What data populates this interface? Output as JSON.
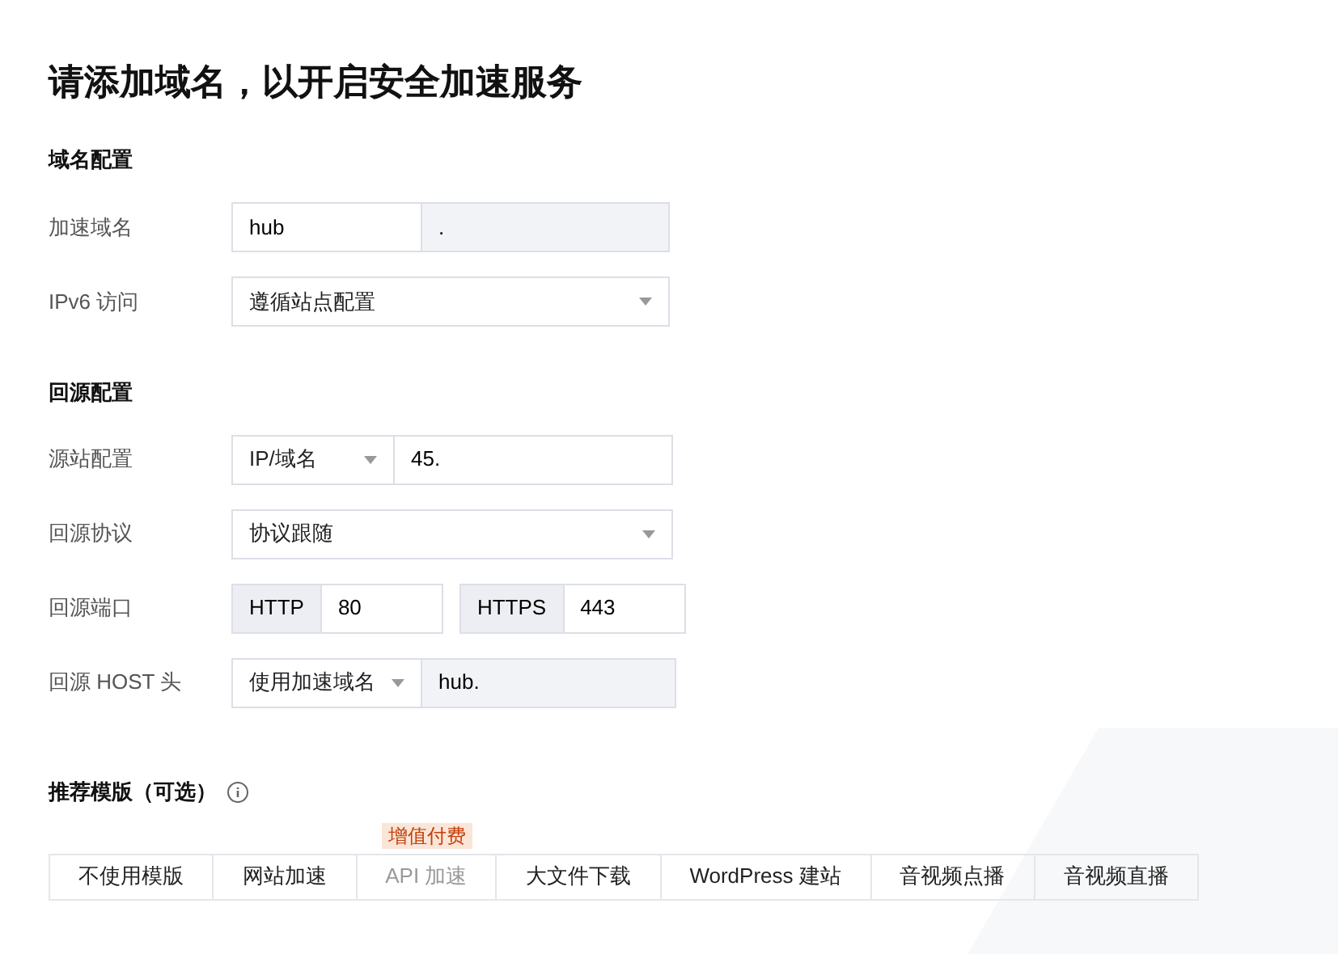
{
  "title": "请添加域名，以开启安全加速服务",
  "domain_section": {
    "heading": "域名配置",
    "accel_domain": {
      "label": "加速域名",
      "value": "hub",
      "suffix": "."
    },
    "ipv6": {
      "label": "IPv6 访问",
      "value": "遵循站点配置"
    }
  },
  "origin_section": {
    "heading": "回源配置",
    "origin": {
      "label": "源站配置",
      "type": "IP/域名",
      "value": "45."
    },
    "protocol": {
      "label": "回源协议",
      "value": "协议跟随"
    },
    "ports": {
      "label": "回源端口",
      "http_label": "HTTP",
      "http_value": "80",
      "https_label": "HTTPS",
      "https_value": "443"
    },
    "host": {
      "label": "回源 HOST 头",
      "type": "使用加速域名",
      "value": "hub."
    }
  },
  "templates": {
    "heading": "推荐模版（可选）",
    "options": [
      {
        "label": "不使用模版",
        "disabled": false
      },
      {
        "label": "网站加速",
        "disabled": false
      },
      {
        "label": "API 加速",
        "disabled": true,
        "badge": "增值付费"
      },
      {
        "label": "大文件下载",
        "disabled": false
      },
      {
        "label": "WordPress 建站",
        "disabled": false
      },
      {
        "label": "音视频点播",
        "disabled": false
      },
      {
        "label": "音视频直播",
        "disabled": false
      }
    ]
  }
}
